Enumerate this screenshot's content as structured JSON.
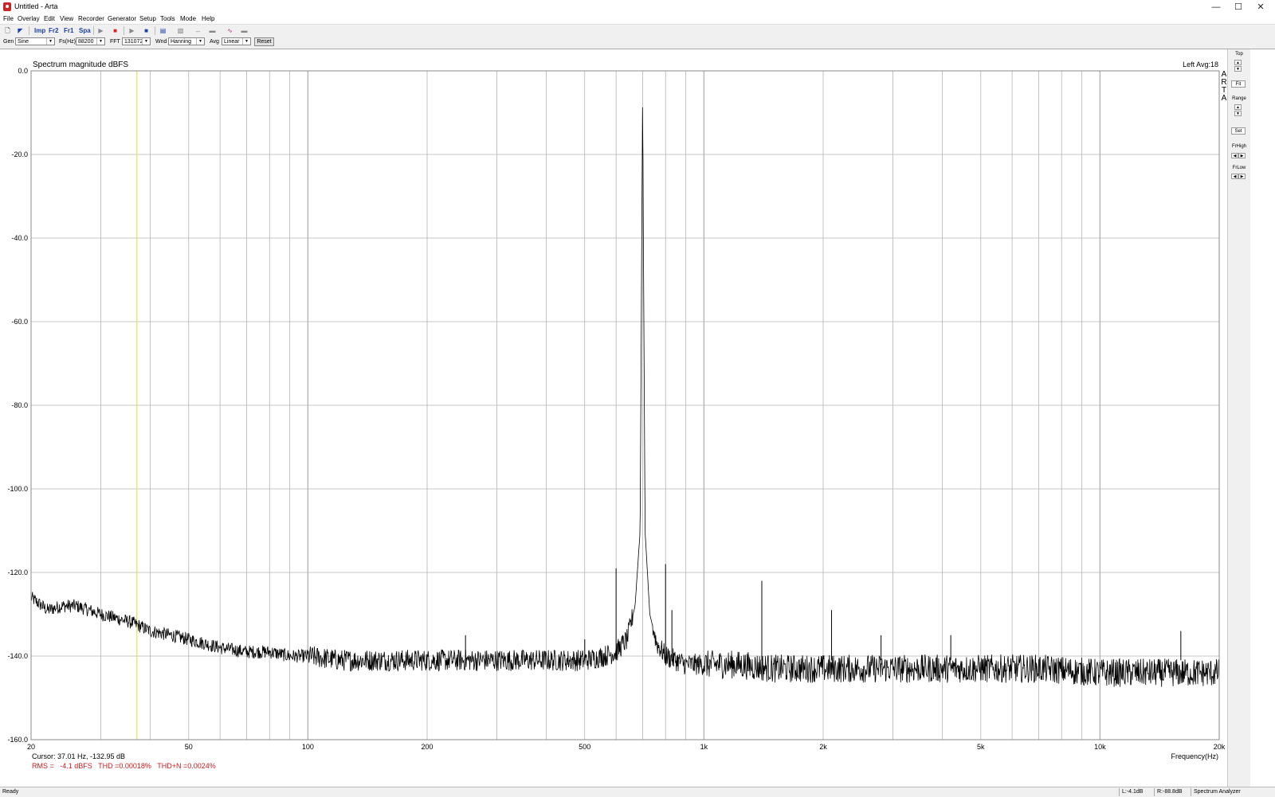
{
  "window": {
    "title": "Untitled - Arta",
    "minimize_glyph": "—",
    "maximize_glyph": "☐",
    "close_glyph": "✕"
  },
  "menu": [
    "File",
    "Overlay",
    "Edit",
    "View",
    "Recorder",
    "Generator",
    "Setup",
    "Tools",
    "Mode",
    "Help"
  ],
  "toolbar": {
    "imp": "Imp",
    "fr2": "Fr2",
    "fr1": "Fr1",
    "spa": "Spa",
    "gen_label": "Gen",
    "gen_value": "Sine",
    "fs_label": "Fs(Hz)",
    "fs_value": "88200",
    "fft_label": "FFT",
    "fft_value": "131072",
    "wnd_label": "Wnd",
    "wnd_value": "Hanning",
    "avg_label": "Avg",
    "avg_value": "Linear",
    "reset_label": "Reset"
  },
  "plot": {
    "title": "Spectrum magnitude dBFS",
    "channel_info": "Left  Avg:18",
    "brand_letters": [
      "A",
      "R",
      "T",
      "A"
    ],
    "x_axis_label": "Frequency(Hz)",
    "x_ticks": [
      {
        "f": 20,
        "label": "20"
      },
      {
        "f": 50,
        "label": "50"
      },
      {
        "f": 100,
        "label": "100"
      },
      {
        "f": 200,
        "label": "200"
      },
      {
        "f": 500,
        "label": "500"
      },
      {
        "f": 1000,
        "label": "1k"
      },
      {
        "f": 2000,
        "label": "2k"
      },
      {
        "f": 5000,
        "label": "5k"
      },
      {
        "f": 10000,
        "label": "10k"
      },
      {
        "f": 20000,
        "label": "20k"
      }
    ],
    "y_ticks": [
      "0.0",
      "-20.0",
      "-40.0",
      "-60.0",
      "-80.0",
      "-100.0",
      "-120.0",
      "-140.0",
      "-160.0"
    ],
    "cursor_readout": "Cursor: 37.01 Hz, -132.95 dB",
    "measurement_readout": "RMS =   -4.1 dBFS   THD =0.00018%   THD+N =0.0024%",
    "cursor_color": "#e0e060",
    "readout_color": "#cc1a1a",
    "trace_color": "#000000",
    "grid_color": "#b4b4b4"
  },
  "side_panel": {
    "top_label": "Top",
    "fit_label": "Fit",
    "range_label": "Range",
    "set_label": "Set",
    "frhigh_label": "FrHigh",
    "frlow_label": "FrLow"
  },
  "status": {
    "ready": "Ready",
    "left_level": "L:-4.1dB",
    "right_level": "R:-88.8dB",
    "mode": "Spectrum Analyzer"
  },
  "chart_data": {
    "type": "line",
    "title": "Spectrum magnitude dBFS",
    "xlabel": "Frequency(Hz)",
    "ylabel": "",
    "x_scale": "log",
    "xlim": [
      20,
      20000
    ],
    "ylim": [
      -160,
      0
    ],
    "grid": true,
    "cursor": {
      "x": 37.01,
      "y": -132.95
    },
    "series": [
      {
        "x": [
          20,
          22,
          24,
          26,
          28,
          30,
          33,
          36,
          40,
          45,
          50,
          55,
          60,
          70,
          80,
          90,
          100,
          120,
          150,
          200,
          250,
          300,
          400,
          500,
          560,
          600,
          640,
          670,
          690,
          700,
          710,
          730,
          760,
          800,
          850,
          900,
          1000,
          1200,
          1500,
          2000,
          3000,
          5000,
          7000,
          10000,
          15000,
          20000
        ],
        "y": [
          -126,
          -129,
          -128,
          -128,
          -129,
          -130,
          -131,
          -132,
          -134,
          -135,
          -136,
          -137,
          -138,
          -139,
          -139,
          -140,
          -140,
          -141,
          -141,
          -141,
          -141,
          -141,
          -141,
          -141,
          -140,
          -139,
          -136,
          -128,
          -110,
          -5,
          -110,
          -130,
          -137,
          -140,
          -141,
          -142,
          -142,
          -142,
          -143,
          -143,
          -143,
          -143,
          -143,
          -144,
          -144,
          -144
        ]
      }
    ],
    "spurs": [
      {
        "x": 600,
        "y": -119
      },
      {
        "x": 800,
        "y": -118
      },
      {
        "x": 1400,
        "y": -122
      },
      {
        "x": 2100,
        "y": -129
      },
      {
        "x": 2800,
        "y": -135
      },
      {
        "x": 250,
        "y": -135
      },
      {
        "x": 500,
        "y": -136
      },
      {
        "x": 830,
        "y": -129
      },
      {
        "x": 4200,
        "y": -135
      },
      {
        "x": 16000,
        "y": -134
      }
    ]
  }
}
